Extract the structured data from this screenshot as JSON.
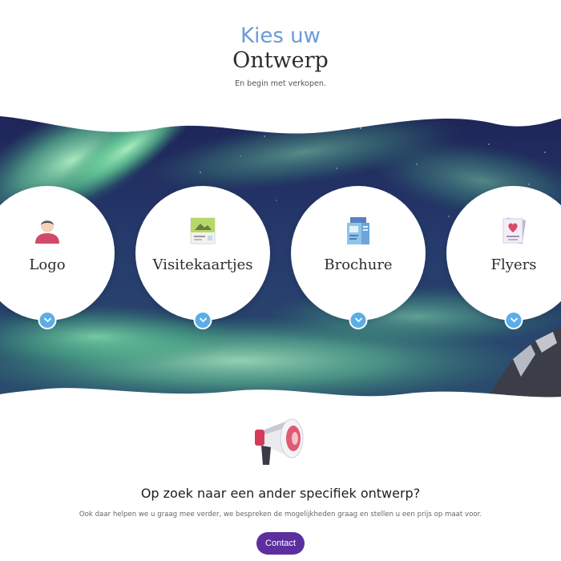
{
  "header": {
    "title_top": "Kies uw",
    "title_main": "Ontwerp",
    "subtitle": "En begin met verkopen."
  },
  "cards": [
    {
      "label": "Logo",
      "icon": "user-avatar-icon"
    },
    {
      "label": "Visitekaartjes",
      "icon": "business-card-icon"
    },
    {
      "label": "Brochure",
      "icon": "brochure-icon"
    },
    {
      "label": "Flyers",
      "icon": "flyer-icon"
    }
  ],
  "cta": {
    "icon": "megaphone-icon",
    "heading": "Op zoek naar een ander specifiek ontwerp?",
    "text": "Ook daar helpen we u graag mee verder, we bespreken de mogelijkheden graag en stellen u een prijs op maat voor.",
    "button_label": "Contact"
  },
  "colors": {
    "accent_blue": "#6b9bd8",
    "toggle_blue": "#5aaee8",
    "button_purple": "#5b2f9e",
    "aurora_green": "#7de0a6",
    "sky_dark": "#1c2452"
  }
}
